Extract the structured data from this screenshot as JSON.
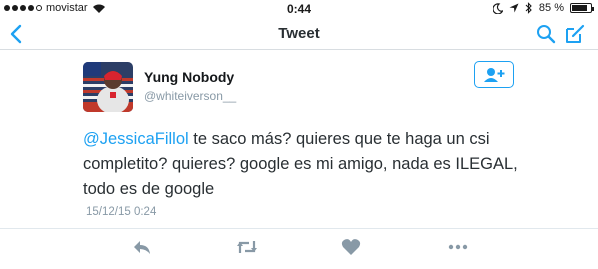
{
  "status_bar": {
    "carrier": "movistar",
    "time": "0:44",
    "battery": "85 %",
    "battery_level": 0.85
  },
  "nav": {
    "title": "Tweet"
  },
  "tweet": {
    "author_name": "Yung Nobody",
    "author_handle": "@whiteiverson__",
    "mention": "@JessicaFillol",
    "text": " te saco más? quieres que te haga un csi completito? quieres? google es mi amigo, nada es ILEGAL, todo es de google",
    "timestamp": "15/12/15 0:24"
  },
  "icons": {
    "back": "chevron-left-icon",
    "search": "search-icon",
    "compose": "compose-icon",
    "follow": "add-user-icon",
    "reply": "reply-icon",
    "retweet": "retweet-icon",
    "like": "heart-icon",
    "more": "more-icon"
  },
  "colors": {
    "accent": "#1da1f2",
    "action_gray": "#8899a6"
  }
}
